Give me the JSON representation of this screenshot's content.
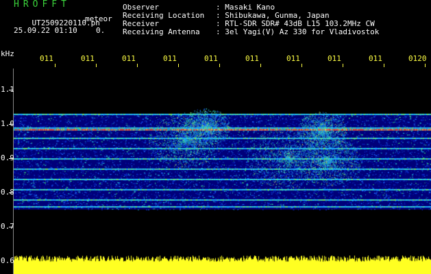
{
  "brand": {
    "label": "HROFFT"
  },
  "file": {
    "name": "UT2509220110.pn",
    "suffix": "meteor",
    "timestamp": "25.09.22 01:10",
    "count": "0."
  },
  "info": {
    "rows": [
      {
        "key": "Observer",
        "value": ": Masaki Kano"
      },
      {
        "key": "Receiving Location",
        "value": ": Shibukawa, Gunma, Japan"
      },
      {
        "key": "Receiver",
        "value": ": RTL-SDR SDR# 43dB L15 103.2MHz CW"
      },
      {
        "key": "Receiving Antenna",
        "value": ": 3el Yagi(V) Az 330 for Vladivostok"
      }
    ]
  },
  "axis": {
    "unit": "kHz",
    "y_ticks": [
      "1.1",
      "1.0",
      "0.9",
      "0.8",
      "0.7",
      "0.6"
    ],
    "x_ticks": [
      "011",
      "011",
      "011",
      "011",
      "011",
      "011",
      "011",
      "011",
      "011",
      "0120"
    ]
  },
  "colors": {
    "brand": "#3bd23b",
    "ticks": "#ffff44",
    "background": "#000000",
    "spectrum_bg": "#00007a"
  },
  "chart_data": {
    "type": "heatmap",
    "ylabel": "kHz",
    "ylim": [
      0.6,
      1.15
    ],
    "y_ticks": [
      1.1,
      1.0,
      0.9,
      0.8,
      0.7,
      0.6
    ],
    "x_ticks": [
      "011",
      "011",
      "011",
      "011",
      "011",
      "011",
      "011",
      "011",
      "011",
      "0120"
    ],
    "signal_band": [
      0.75,
      1.03
    ],
    "carrier_lines_khz": [
      1.03,
      0.99,
      0.96,
      0.93,
      0.9,
      0.87,
      0.84,
      0.81,
      0.78,
      0.76
    ],
    "strong_carrier_khz": 0.985
  }
}
